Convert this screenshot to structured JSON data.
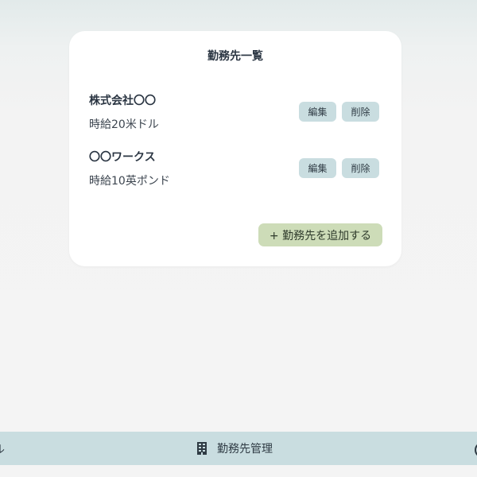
{
  "card": {
    "title": "勤務先一覧",
    "items": [
      {
        "name": "株式会社〇〇",
        "wage": "時給20米ドル",
        "edit_label": "編集",
        "delete_label": "削除"
      },
      {
        "name": "〇〇ワークス",
        "wage": "時給10英ポンド",
        "edit_label": "編集",
        "delete_label": "削除"
      }
    ],
    "add_label": "+ 勤務先を追加する"
  },
  "bottom_nav": {
    "left_label": "ル",
    "center_label": "勤務先管理",
    "center_icon": "building-icon",
    "right_icon": "circle-icon"
  },
  "colors": {
    "button_bg": "#c9dde0",
    "add_button_bg": "#cddcb8",
    "nav_bg": "#c9dde0",
    "text": "#2a3542"
  }
}
